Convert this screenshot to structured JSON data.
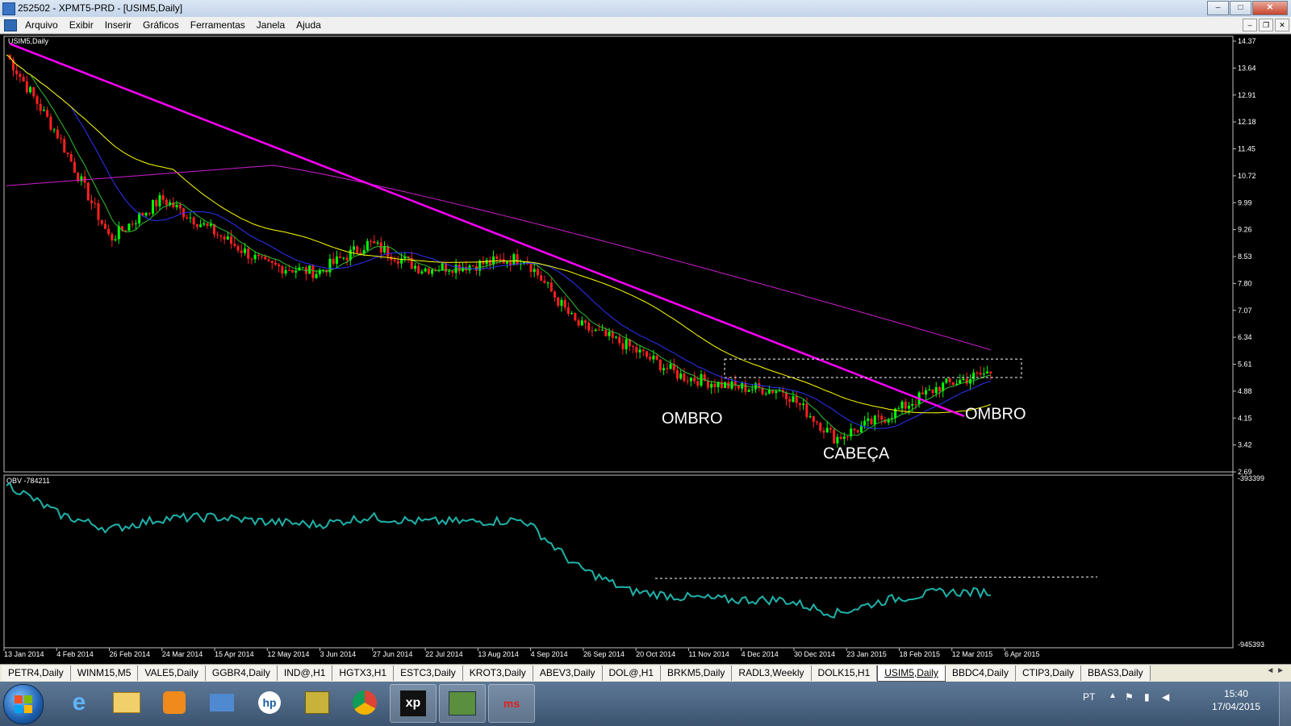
{
  "window": {
    "title": "252502 - XPMT5-PRD - [USIM5,Daily]",
    "controls": [
      "–",
      "□",
      "✕"
    ]
  },
  "menu": {
    "items": [
      "Arquivo",
      "Exibir",
      "Inserir",
      "Gráficos",
      "Ferramentas",
      "Janela",
      "Ajuda"
    ],
    "doc_controls": [
      "–",
      "❐",
      "✕"
    ]
  },
  "chart": {
    "symbol_label": "USIM5,Daily",
    "price_ticks": [
      "14.37",
      "13.64",
      "12.91",
      "12.18",
      "11.45",
      "10.72",
      "9.99",
      "9.26",
      "8.53",
      "7.80",
      "7.07",
      "6.34",
      "5.61",
      "4.88",
      "4.15",
      "3.42",
      "2.69"
    ],
    "annotations": {
      "left_shoulder": "OMBRO",
      "head": "CABEÇA",
      "right_shoulder": "OMBRO"
    },
    "obv_label": "OBV -784211",
    "obv_ticks": [
      "-393399",
      "-945393"
    ],
    "date_ticks": [
      "13 Jan 2014",
      "4 Feb 2014",
      "26 Feb 2014",
      "24 Mar 2014",
      "15 Apr 2014",
      "12 May 2014",
      "3 Jun 2014",
      "27 Jun 2014",
      "22 Jul 2014",
      "13 Aug 2014",
      "4 Sep 2014",
      "26 Sep 2014",
      "20 Oct 2014",
      "11 Nov 2014",
      "4 Dec 2014",
      "30 Dec 2014",
      "23 Jan 2015",
      "18 Feb 2015",
      "12 Mar 2015",
      "6 Apr 2015"
    ],
    "colors": {
      "background": "#000000",
      "trendline": "#ff00ff",
      "ma_long": "#d21dd2",
      "ma_mid": "#ffff00",
      "ma_short_blue": "#3030ff",
      "ma_short_green": "#30c030",
      "up_candle": "#00ff00",
      "down_candle": "#ff2020",
      "obv": "#20b2aa",
      "axis_text": "#ffffff"
    }
  },
  "chart_data": {
    "type": "line",
    "title": "USIM5,Daily",
    "x": [
      "13 Jan 2014",
      "4 Feb 2014",
      "26 Feb 2014",
      "24 Mar 2014",
      "15 Apr 2014",
      "12 May 2014",
      "3 Jun 2014",
      "27 Jun 2014",
      "22 Jul 2014",
      "13 Aug 2014",
      "4 Sep 2014",
      "26 Sep 2014",
      "20 Oct 2014",
      "11 Nov 2014",
      "4 Dec 2014",
      "30 Dec 2014",
      "23 Jan 2015",
      "18 Feb 2015",
      "12 Mar 2015",
      "6 Apr 2015"
    ],
    "series": [
      {
        "name": "USIM5",
        "values": [
          14.0,
          11.8,
          9.0,
          10.1,
          9.2,
          8.3,
          8.1,
          8.9,
          8.2,
          8.3,
          8.5,
          6.7,
          6.1,
          5.3,
          5.0,
          4.9,
          3.6,
          4.2,
          5.0,
          5.4
        ]
      },
      {
        "name": "OBV",
        "values": [
          -420000,
          -520000,
          -570000,
          -535000,
          -530000,
          -545000,
          -555000,
          -530000,
          -545000,
          -545000,
          -540000,
          -690000,
          -770000,
          -790000,
          -800000,
          -800000,
          -845000,
          -800000,
          -775000,
          -775000
        ]
      }
    ],
    "ylim": [
      2.69,
      14.37
    ],
    "ylim_obv": [
      -945393,
      -393399
    ]
  },
  "tabs": [
    "PETR4,Daily",
    "WINM15,M5",
    "VALE5,Daily",
    "GGBR4,Daily",
    "IND@,H1",
    "HGTX3,H1",
    "ESTC3,Daily",
    "KROT3,Daily",
    "ABEV3,Daily",
    "DOL@,H1",
    "BRKM5,Daily",
    "RADL3,Weekly",
    "DOLK15,H1",
    "USIM5,Daily",
    "BBDC4,Daily",
    "CTIP3,Daily",
    "BBAS3,Daily"
  ],
  "active_tab": "USIM5,Daily",
  "taskbar": {
    "apps": [
      "ie-icon",
      "folder-icon",
      "media-icon",
      "network-icon",
      "hp-icon",
      "archive-icon",
      "chrome-icon",
      "xp",
      "metatrader-icon",
      "ms"
    ],
    "lang": "PT",
    "time": "15:40",
    "date": "17/04/2015"
  }
}
